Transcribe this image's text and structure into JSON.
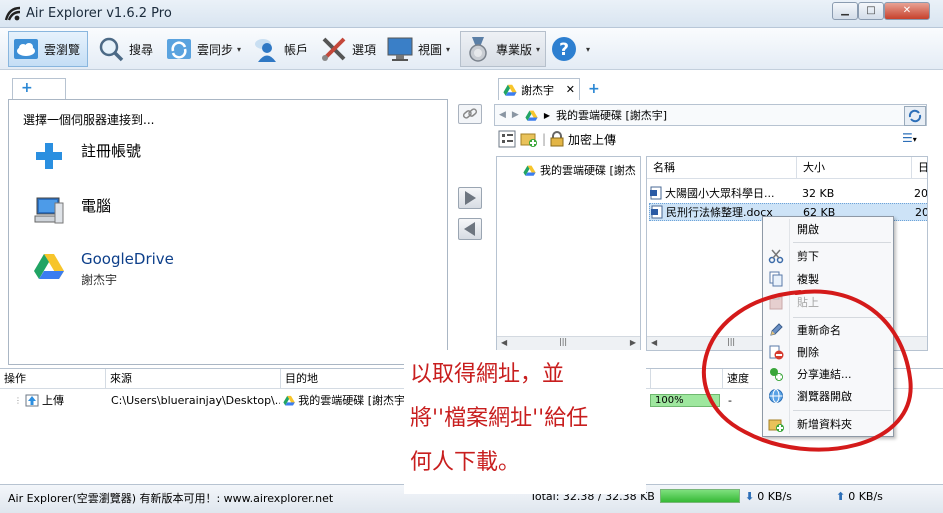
{
  "window": {
    "title": "Air Explorer v1.6.2 Pro",
    "min_glyph": "▁",
    "max_glyph": "□",
    "close_glyph": "✕"
  },
  "toolbar": {
    "cloud_browse": "雲瀏覽",
    "search": "搜尋",
    "cloud_sync": "雲同步",
    "accounts": "帳戶",
    "options": "選項",
    "view": "視圖",
    "pro": "專業版",
    "dropdown_glyph": "▾"
  },
  "left_pane": {
    "tab_add": "+",
    "connect_prompt": "選擇一個伺服器連接到...",
    "accounts": [
      {
        "name": "註冊帳號",
        "sub": "",
        "icon": "plus-icon"
      },
      {
        "name": "電腦",
        "sub": "",
        "icon": "computer-icon"
      },
      {
        "name": "GoogleDrive",
        "sub": "謝杰宇",
        "icon": "google-drive-icon"
      }
    ]
  },
  "right_pane": {
    "tab_label": "謝杰宇",
    "tab_close": "✕",
    "tab_add": "+",
    "address": "我的雲端硬碟 [謝杰宇]",
    "encrypted_upload": "加密上傳",
    "tree_item": "我的雲端硬碟 [謝杰",
    "columns": {
      "name": "名稱",
      "size": "大小",
      "date": "日"
    },
    "files": [
      {
        "name": "大陽國小大眾科學日...",
        "size": "32 KB",
        "date": "20"
      },
      {
        "name": "民刑行法條整理.docx",
        "size": "62 KB",
        "date": "20"
      }
    ]
  },
  "transfer": {
    "columns": {
      "operation": "操作",
      "source": "來源",
      "destination": "目的地",
      "speed": "速度"
    },
    "row": {
      "operation": "上傳",
      "source": "C:\\Users\\bluerainjay\\Desktop\\...",
      "destination": "我的雲端硬碟 [謝杰宇",
      "progress": "100%",
      "progress_fraction": 1.0,
      "speed": "-"
    }
  },
  "status": {
    "text": "Air Explorer(空雲瀏覽器) 有新版本可用！: www.airexplorer.net",
    "total": "Total: 32.38 / 32.38 KB",
    "progress_fraction": 1.0,
    "download": "0 KB/s",
    "upload": "0 KB/s"
  },
  "annotation": {
    "line1": "以取得網址，並",
    "line2": "將''檔案網址''給任",
    "line3": "何人下載。"
  },
  "context_menu": {
    "items": [
      {
        "label": "開啟",
        "icon": "",
        "enabled": true
      },
      {
        "label": "剪下",
        "icon": "scissors-icon",
        "enabled": true
      },
      {
        "label": "複製",
        "icon": "copy-icon",
        "enabled": true
      },
      {
        "label": "貼上",
        "icon": "paste-icon",
        "enabled": false
      },
      {
        "label": "重新命名",
        "icon": "pencil-icon",
        "enabled": true
      },
      {
        "label": "刪除",
        "icon": "delete-icon",
        "enabled": true
      },
      {
        "label": "分享連結...",
        "icon": "share-link-icon",
        "enabled": true
      },
      {
        "label": "瀏覽器開啟",
        "icon": "browser-icon",
        "enabled": true
      },
      {
        "label": "新增資料夾",
        "icon": "new-folder-icon",
        "enabled": true
      }
    ]
  },
  "colors": {
    "annotation_red": "#c81e1e",
    "selection_blue": "#cde3f7",
    "progress_green": "#36b936"
  }
}
